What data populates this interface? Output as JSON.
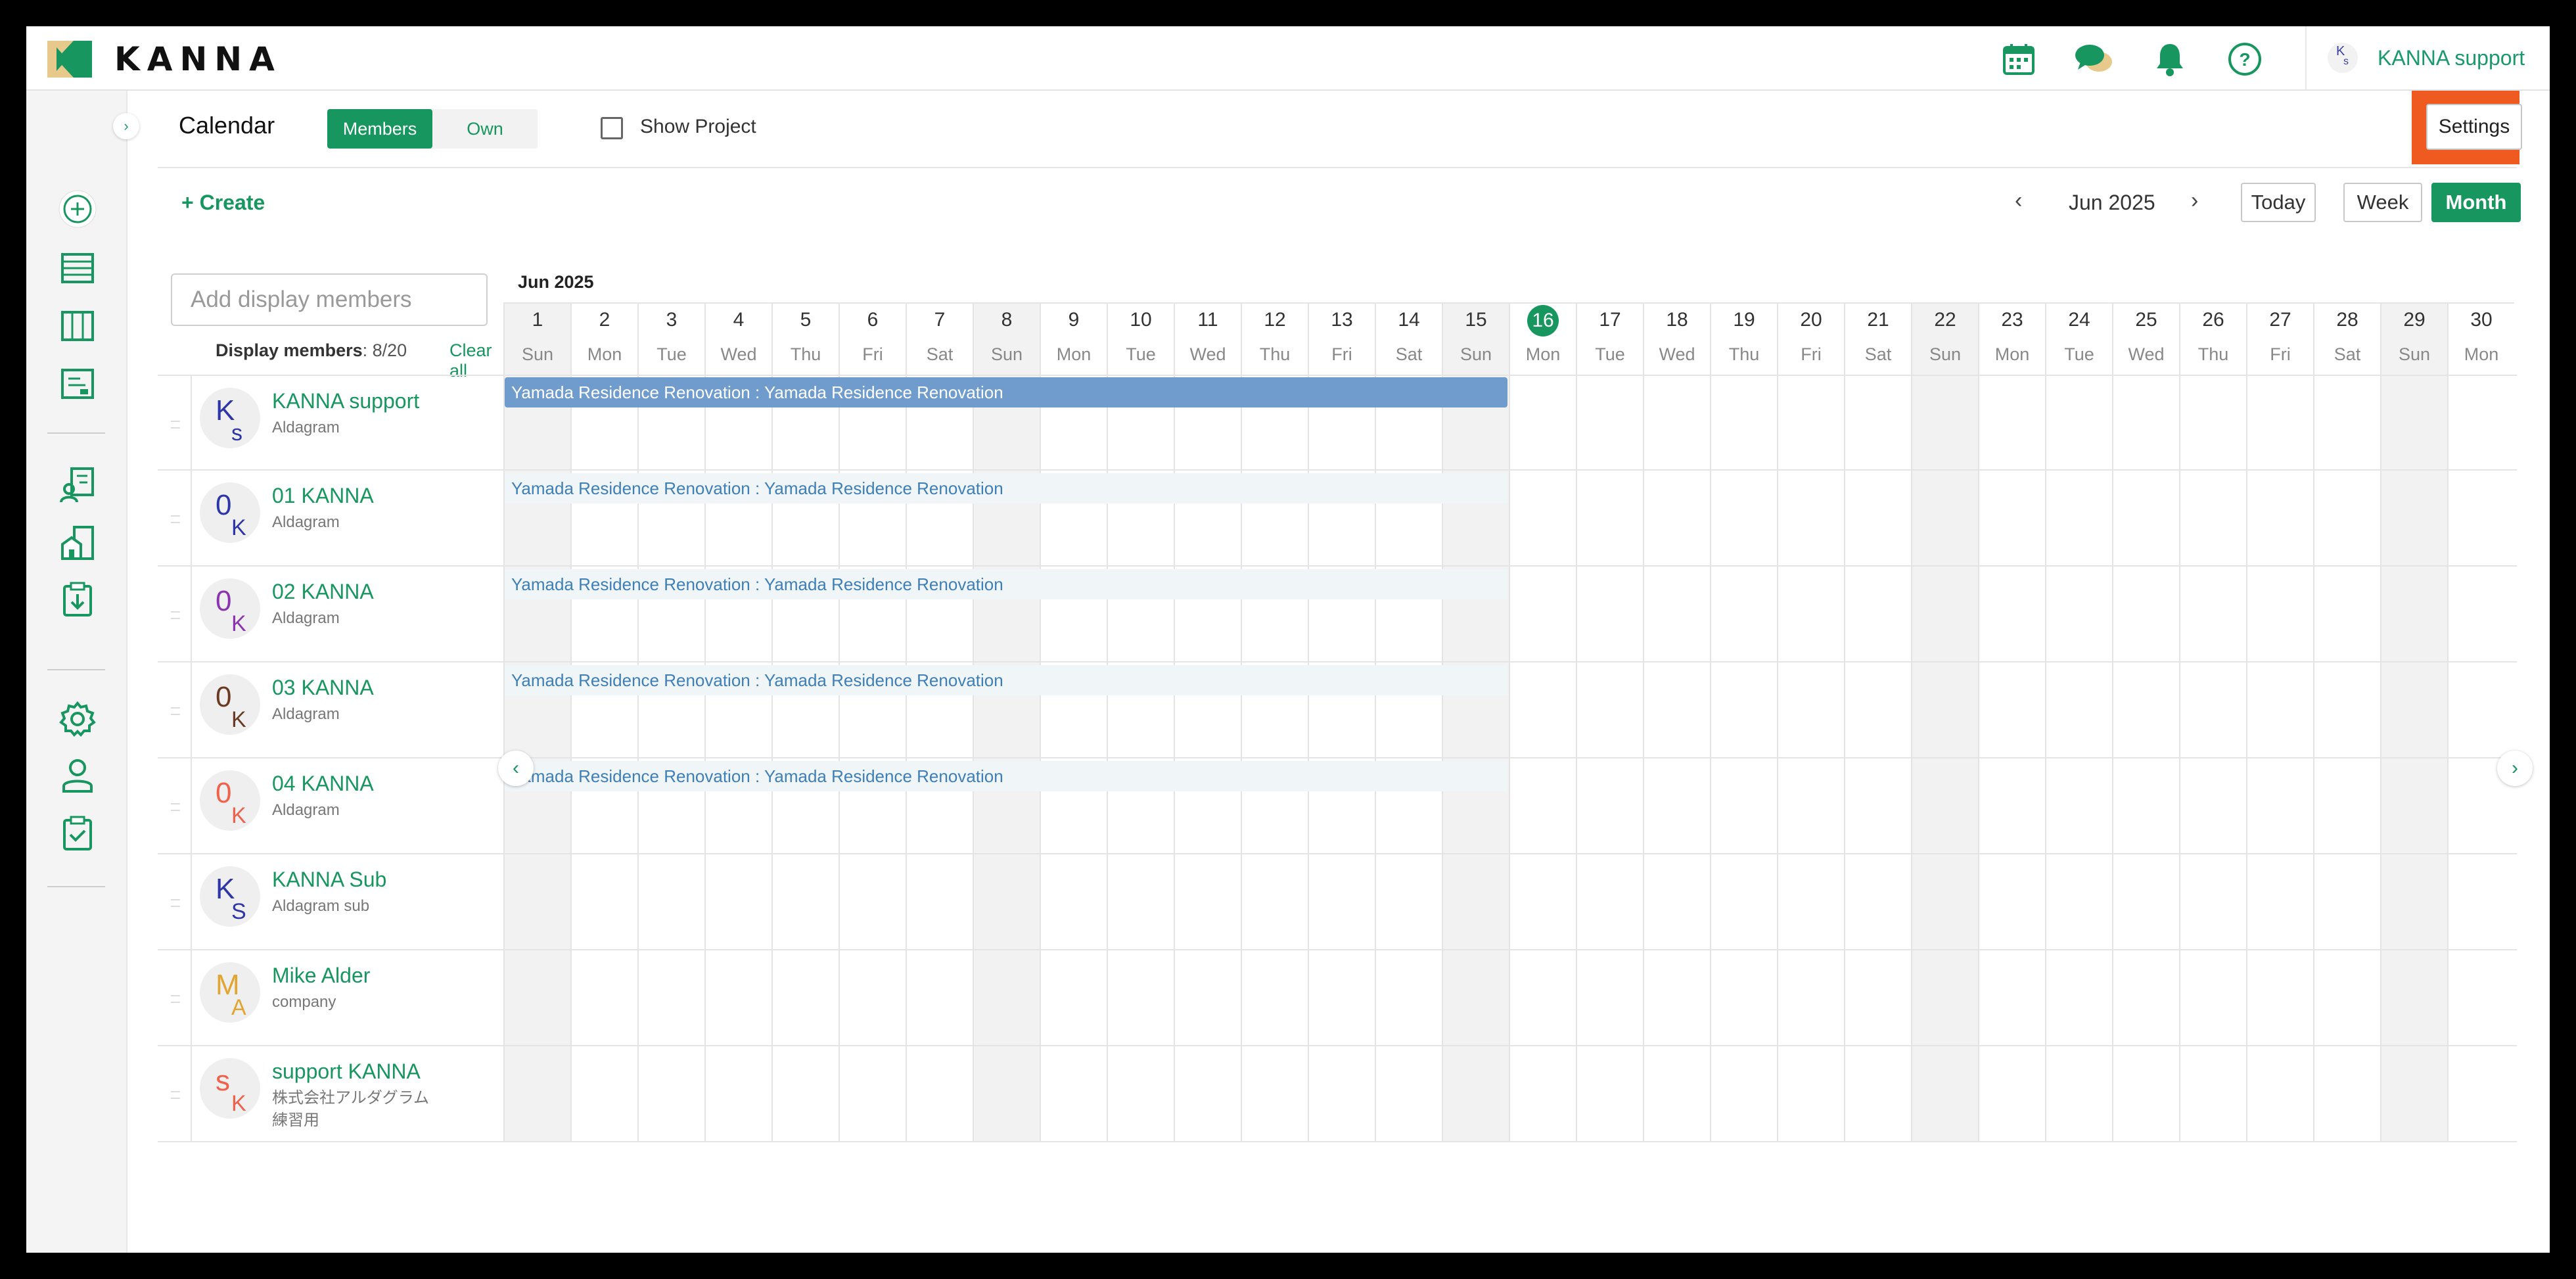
{
  "header": {
    "brand": "KANNA",
    "icons": [
      "calendar-icon",
      "chat-icon",
      "bell-icon",
      "help-icon"
    ],
    "user": {
      "initials_top": "K",
      "initials_bottom": "s",
      "name": "KANNA support"
    }
  },
  "sidebar": {
    "icons": [
      "create-icon",
      "list-icon",
      "board-icon",
      "report-icon",
      "documents-icon",
      "sites-icon",
      "clipboard-download-icon",
      "settings-gear-icon",
      "user-icon",
      "clipboard-check-icon"
    ]
  },
  "calendar": {
    "title": "Calendar",
    "tabs": {
      "members": "Members",
      "own": "Own"
    },
    "show_project_label": "Show Project",
    "settings_label": "Settings",
    "create_label": "+ Create",
    "prev": "‹",
    "next": "›",
    "month": "Jun 2025",
    "today_label": "Today",
    "week_label": "Week",
    "month_view_label": "Month",
    "add_members_placeholder": "Add display members",
    "display_members_label": "Display members",
    "display_members_count": ": 8/20",
    "clear_all": "Clear all",
    "grid_month_label": "Jun 2025",
    "today_day": 16,
    "days": [
      {
        "n": "1",
        "w": "Sun"
      },
      {
        "n": "2",
        "w": "Mon"
      },
      {
        "n": "3",
        "w": "Tue"
      },
      {
        "n": "4",
        "w": "Wed"
      },
      {
        "n": "5",
        "w": "Thu"
      },
      {
        "n": "6",
        "w": "Fri"
      },
      {
        "n": "7",
        "w": "Sat"
      },
      {
        "n": "8",
        "w": "Sun"
      },
      {
        "n": "9",
        "w": "Mon"
      },
      {
        "n": "10",
        "w": "Tue"
      },
      {
        "n": "11",
        "w": "Wed"
      },
      {
        "n": "12",
        "w": "Thu"
      },
      {
        "n": "13",
        "w": "Fri"
      },
      {
        "n": "14",
        "w": "Sat"
      },
      {
        "n": "15",
        "w": "Sun"
      },
      {
        "n": "16",
        "w": "Mon"
      },
      {
        "n": "17",
        "w": "Tue"
      },
      {
        "n": "18",
        "w": "Wed"
      },
      {
        "n": "19",
        "w": "Thu"
      },
      {
        "n": "20",
        "w": "Fri"
      },
      {
        "n": "21",
        "w": "Sat"
      },
      {
        "n": "22",
        "w": "Sun"
      },
      {
        "n": "23",
        "w": "Mon"
      },
      {
        "n": "24",
        "w": "Tue"
      },
      {
        "n": "25",
        "w": "Wed"
      },
      {
        "n": "26",
        "w": "Thu"
      },
      {
        "n": "27",
        "w": "Fri"
      },
      {
        "n": "28",
        "w": "Sat"
      },
      {
        "n": "29",
        "w": "Sun"
      },
      {
        "n": "30",
        "w": "Mon"
      }
    ],
    "members": [
      {
        "name": "KANNA support",
        "company": "Aldagram",
        "i1": "K",
        "i2": "s",
        "c1": "#2e35a8",
        "c2": "#2e35a8",
        "event": "Yamada Residence Renovation : Yamada Residence Renovation",
        "event_style": "main"
      },
      {
        "name": "01 KANNA",
        "company": "Aldagram",
        "i1": "0",
        "i2": "K",
        "c1": "#2e35a8",
        "c2": "#2e35a8",
        "event": "Yamada Residence Renovation : Yamada Residence Renovation",
        "event_style": "light"
      },
      {
        "name": "02 KANNA",
        "company": "Aldagram",
        "i1": "0",
        "i2": "K",
        "c1": "#8a34b0",
        "c2": "#8a34b0",
        "event": "Yamada Residence Renovation : Yamada Residence Renovation",
        "event_style": "light"
      },
      {
        "name": "03 KANNA",
        "company": "Aldagram",
        "i1": "0",
        "i2": "K",
        "c1": "#6b3a24",
        "c2": "#6b3a24",
        "event": "Yamada Residence Renovation : Yamada Residence Renovation",
        "event_style": "light"
      },
      {
        "name": "04 KANNA",
        "company": "Aldagram",
        "i1": "0",
        "i2": "K",
        "c1": "#f0604a",
        "c2": "#f0604a",
        "event": "Yamada Residence Renovation : Yamada Residence Renovation",
        "event_style": "light"
      },
      {
        "name": "KANNA Sub",
        "company": "Aldagram sub",
        "i1": "K",
        "i2": "S",
        "c1": "#2e35a8",
        "c2": "#2e35a8",
        "event": "",
        "event_style": ""
      },
      {
        "name": "Mike Alder",
        "company": "company",
        "i1": "M",
        "i2": "A",
        "c1": "#e3a532",
        "c2": "#e3a532",
        "event": "",
        "event_style": ""
      },
      {
        "name": "support KANNA",
        "company": "株式会社アルダグラム\n練習用",
        "i1": "s",
        "i2": "K",
        "c1": "#f0604a",
        "c2": "#f0604a",
        "event": "",
        "event_style": ""
      }
    ]
  },
  "colors": {
    "accent": "#17975f",
    "highlight": "#ee5a1f",
    "event_bar": "#6f9ccc"
  }
}
